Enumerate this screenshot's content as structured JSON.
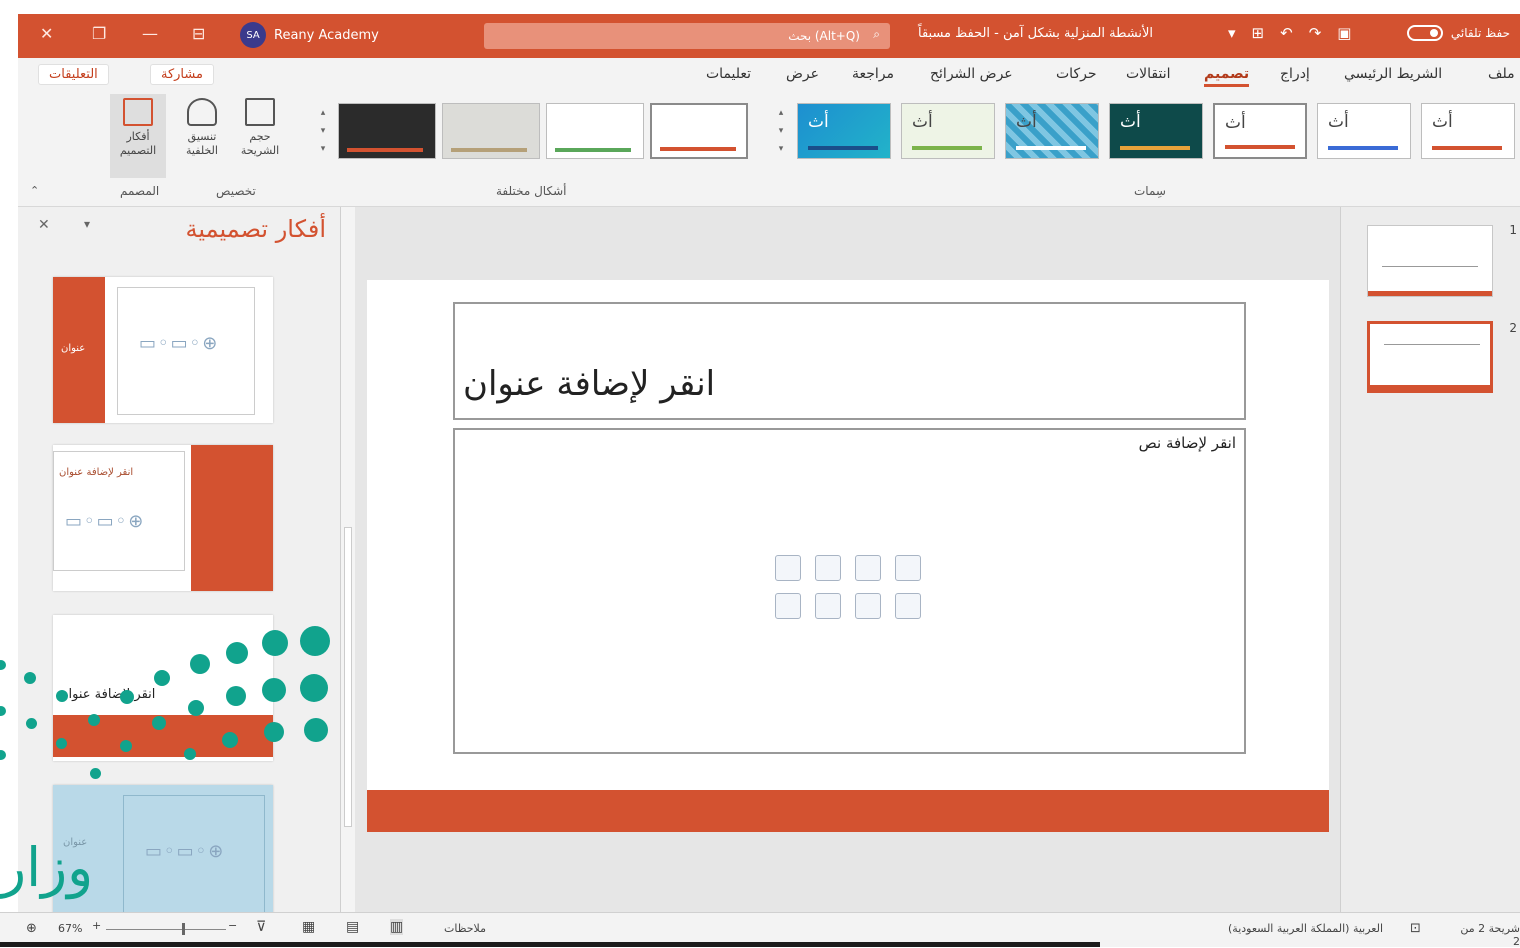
{
  "titlebar": {
    "controls": [
      "✕",
      "❐",
      "—",
      "⊟"
    ],
    "user_initials": "SA",
    "user_name": "Reany Academy",
    "search_text": "بحث (Alt+Q)",
    "doc_title": "الأنشطة المنزلية بشكل آمن - الحفظ مسبقاً",
    "autosave_label": "حفظ تلقائي"
  },
  "ribbon": {
    "tabs": [
      "ملف",
      "الشريط الرئيسي",
      "إدراج",
      "تصميم",
      "انتقالات",
      "حركات",
      "عرض الشرائح",
      "مراجعة",
      "عرض",
      "تعليمات"
    ],
    "active_tab": "تصميم",
    "share": "مشاركة",
    "comments": "التعليقات",
    "group_themes": "سِمات",
    "group_variants": "أشكال مختلفة",
    "group_customize": "تخصيص",
    "group_designer": "المصمم",
    "btn_design_ideas": "أفكار التصميم",
    "btn_format_bg": "تنسيق الخلفية",
    "btn_slide_size": "حجم الشريحة",
    "theme_glyph": "أث"
  },
  "design_pane": {
    "title": "أفكار تصميمية",
    "close": "✕",
    "menu": "▾",
    "idea_label_1": "عنوان",
    "idea_label_2": "انقر لإضافة عنوان",
    "idea_label_3": "انقر لإضافة عنوان",
    "idea_label_4": "عنوان"
  },
  "slide": {
    "title_placeholder": "انقر لإضافة عنوان",
    "content_placeholder": "انقر لإضافة نص"
  },
  "slide_panel": {
    "numbers": [
      "1",
      "2"
    ]
  },
  "statusbar": {
    "slide_info": "شريحة 2 من 2",
    "language": "العربية (المملكة العربية السعودية)",
    "notes": "ملاحظات",
    "zoom": "67%"
  },
  "watermark": {
    "text": "وزار"
  },
  "colors": {
    "accent": "#d35230",
    "teal": "#11a38d"
  }
}
